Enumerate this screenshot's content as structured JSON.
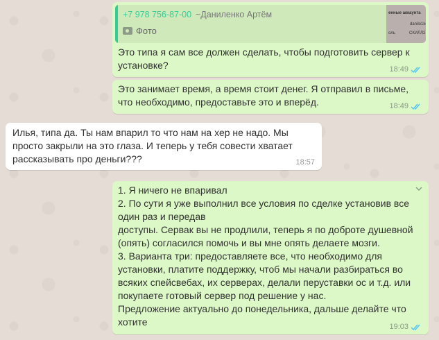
{
  "messages": [
    {
      "quote": {
        "phone": "+7 978 756-87-00",
        "author": "~Даниленко Артём",
        "type_label": "Фото",
        "thumb_lines": [
          "енные аккаунта",
          "danilo1ko",
          "оль",
          "СКИЛЛ2"
        ]
      },
      "text": "Это типа я сам все должен сделать, чтобы подготовить сервер к\nустановке?",
      "time": "18:49"
    },
    {
      "text": "Это занимает время, а время стоит денег. Я отправил в письме,\nчто необходимо, предоставьте это и вперёд.",
      "time": "18:49"
    },
    {
      "text": "Илья, типа да. Ты нам впарил то что нам на хер не надо. Мы\nпросто закрыли на это глаза. И теперь у тебя совести хватает\nрассказывать про деньги???",
      "time": "18:57"
    },
    {
      "text": "1. Я ничего не впаривал\n2. По сути я уже выполнил все условия по сделке установив все\nодин раз и передав\nдоступы. Сервак вы не продлили, теперь я по доброте душевной\n(опять) согласился помочь и вы мне опять делаете мозги.\n3. Варианта три: предоставляете все, что необходимо для\nустановки, платите поддержку, чтоб мы начали разбираться во\nвсяких спейсвебах, их серверах, делали перуставки ос и т.д. или\nпокупаете готовый сервер под решение у нас.\nПредложение актуально до понедельника, дальше делайте что\nхотите",
      "time": "19:03"
    }
  ],
  "colors": {
    "outgoing": "#dcf8c6",
    "incoming": "#ffffff",
    "read_ticks": "#4fc3f7",
    "quote_accent": "#35cd96"
  },
  "icons": [
    "camera-icon",
    "double-check-icon",
    "chevron-down-icon"
  ]
}
